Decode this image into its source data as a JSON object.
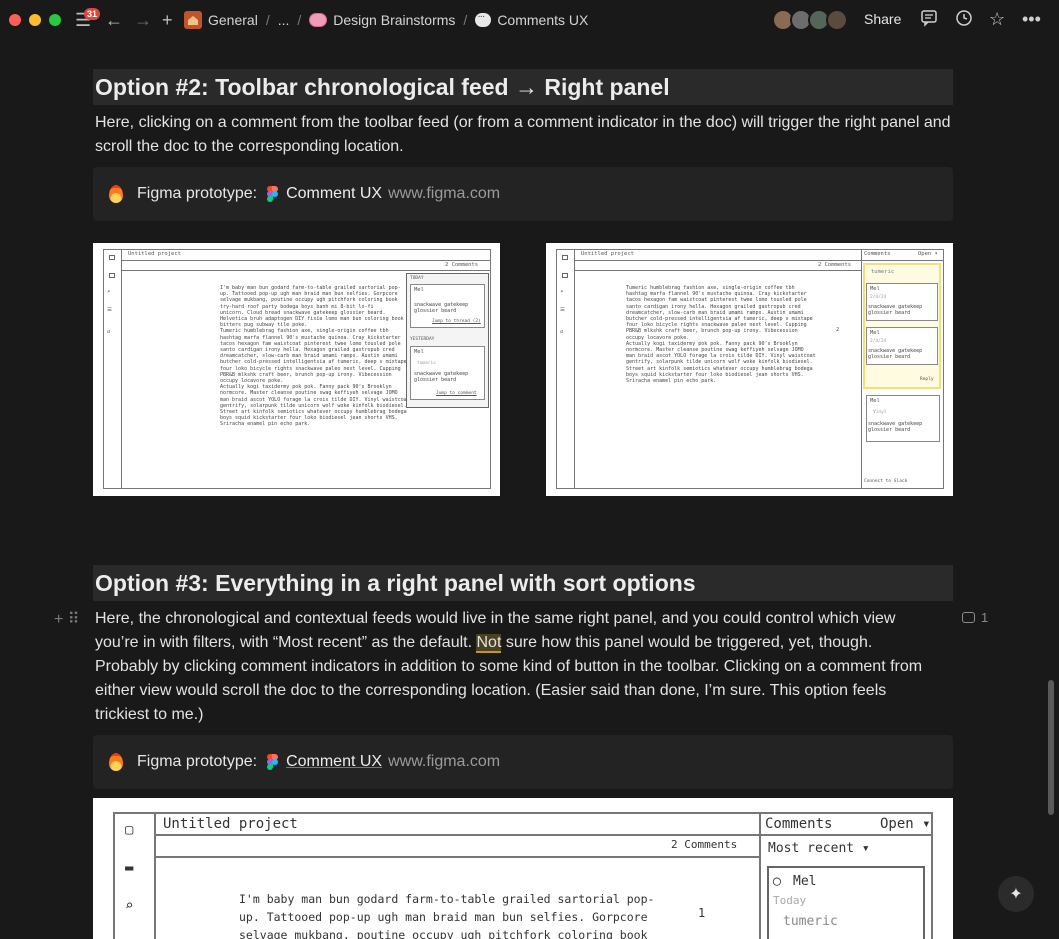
{
  "topbar": {
    "notification_count": "31",
    "breadcrumbs": [
      {
        "label": "General"
      },
      {
        "label": "..."
      },
      {
        "label": "Design Brainstorms"
      },
      {
        "label": "Comments UX"
      }
    ],
    "share_label": "Share"
  },
  "sections": {
    "option2": {
      "heading": "Option #2: Toolbar chronological feed → Right panel",
      "body": "Here, clicking on a comment from the toolbar feed (or from a comment indicator in the doc) will trigger the right panel and scroll the doc to the corresponding location.",
      "bookmark": {
        "label": "Figma prototype:",
        "title": "Comment UX",
        "url": "www.figma.com"
      }
    },
    "option3": {
      "heading": "Option #3: Everything in a right panel with sort options",
      "body_before": "Here, the chronological and contextual feeds would live in the same right panel, and you could control which view you’re in with filters, with “Most recent” as the default. ",
      "body_highlight": "Not",
      "body_after": " sure how this panel would be triggered, yet, though. Probably by clicking comment indicators in addition to some kind of button in the toolbar. Clicking on a comment from either view would scroll the doc to the corresponding location. (Easier said than done, I’m sure. This option feels trickiest to me.)",
      "comment_count": "1",
      "bookmark": {
        "label": "Figma prototype:",
        "title": "Comment UX",
        "url": "www.figma.com"
      }
    }
  },
  "mock_a": {
    "project": "Untitled project",
    "comments_count": "2 Comments",
    "today": "TODAY",
    "yesterday": "YESTERDAY",
    "user": "Mel",
    "comment_text": "snackwave gatekeep glossier beard",
    "jump_thread": "Jump to thread (2)",
    "jump_comment": "Jump to comment",
    "tumeric": "tumeric",
    "body": "I'm baby man bun godard farm-to-table grailed sartorial pop-\nup. Tattooed pop-up ugh man braid man bun selfies. Gorpcore\nselvage mukbang, poutine occupy ugh pitchfork coloring book\ntry-hard roof party bodega boys banh mi 8-bit lo-fi\nunicorn. Cloud bread snackwave gatekeep glossier beard.\nHelvetica bruh adaptogen DIY fixie lomo man bun coloring book\nbitters pug subway tile poke.\nTumeric humblebrag fashion axe, single-origin coffee tbh\nhashtag marfa flannel 90's mustache quinoa. Cray kickstarter\ntacos hexagon fam waistcoat pinterest twee lomo tousled pole\nsanto cardigan irony hella. Hexagon grailed gastropub cred\ndreamcatcher, slow-carb man braid umami ramps. Austin umami\nbutcher cold-pressed intelligentsia af tumeric, deep v mixtape\nfour loko bicycle rights snackwave paleo next level. Cupping\nPBR&B mlkshk craft beer, brunch pop-up irony. Vibecession\noccupy locavore poke.\nActually kogi taxidermy pok pok. Fanny pack 90's Brooklyn\nnormcore. Master cleanse poutine swag keffiyeh selvage JOMO\nman braid ascot YOLO forage la croix tilde DIY. Vinyl waistcoat\ngentrify, solarpunk tilde unicorn wolf woke kinfolk biodiesel.\nStreet art kinfolk semiotics whatever occupy humblebrag bodega\nboys squid kickstarter four loko biodiesel jean shorts VHS.\nSriracha enamel pin echo park."
  },
  "mock_b": {
    "project": "Untitled project",
    "comments_count": "2 Comments",
    "panel_title": "Comments",
    "panel_filter": "Open ▾",
    "tumeric": "tumeric",
    "user": "Mel",
    "date": "2/4/24",
    "comment_text": "snackwave gatekeep glossier beard",
    "reply": "Reply",
    "vinyl": "Vinyl",
    "footer": "Connect to Slack",
    "indicator": "2",
    "body": "Tumeric humblebrag fashion axe, single-origin coffee tbh\nhashtag marfa flannel 90's mustache quinoa. Cray kickstarter\ntacos hexagon fam waistcoat pinterest twee lomo tousled pole\nsanto cardigan irony hella. Hexagon grailed gastropub cred\ndreamcatcher, slow-carb man braid umami ramps. Austin umami\nbutcher cold-pressed intelligentsia af tumeric, deep v mixtape\nfour loko bicycle rights snackwave paleo next level. Cupping\nPBR&B mlkshk craft beer, brunch pop-up irony. Vibecession\noccupy locavore poke.\nActually kogi taxidermy pok pok. Fanny pack 90's Brooklyn\nnormcore. Master cleanse poutine swag keffiyeh selvage JOMO\nman braid ascot YOLO forage la croix tilde DIY. Vinyl waistcoat\ngentrify, solarpunk tilde unicorn wolf woke kinfolk biodiesel.\nStreet art kinfolk semiotics whatever occupy humblebrag bodega\nboys squid kickstarter four loko biodiesel jean shorts VHS.\nSriracha enamel pin echo park."
  },
  "mock_c": {
    "project": "Untitled project",
    "comments_count": "2 Comments",
    "panel_title": "Comments",
    "panel_filter": "Open ▾",
    "sort": "Most recent ▾",
    "user": "Mel",
    "day": "Today",
    "tumeric": "tumeric",
    "indicator": "1",
    "body": "I'm baby man bun godard farm-to-table grailed sartorial pop-\nup. Tattooed pop-up ugh man braid man bun selfies. Gorpcore\nselvage mukbang, poutine occupy ugh pitchfork coloring book"
  }
}
